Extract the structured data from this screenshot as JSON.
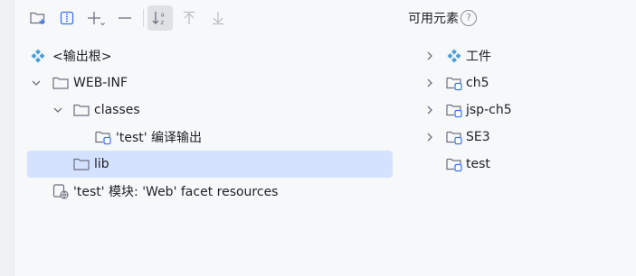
{
  "toolbar": {
    "buttons": [
      {
        "icon": "new-folder-icon"
      },
      {
        "icon": "module-archive-icon"
      },
      {
        "icon": "add-icon"
      },
      {
        "icon": "remove-icon"
      },
      {
        "icon": "sort-alphabetically-icon"
      },
      {
        "icon": "move-up-icon"
      },
      {
        "icon": "move-down-icon"
      }
    ]
  },
  "output_tree": [
    {
      "label": "<输出根>",
      "icon": "output-root-icon",
      "level": 0,
      "expand": "none"
    },
    {
      "label": "WEB-INF",
      "icon": "folder-icon",
      "level": 1,
      "expand": "expanded"
    },
    {
      "label": "classes",
      "icon": "folder-icon",
      "level": 2,
      "expand": "expanded"
    },
    {
      "label": "'test' 编译输出",
      "icon": "module-output-icon",
      "level": 3,
      "expand": "none"
    },
    {
      "label": "lib",
      "icon": "folder-icon",
      "level": 2,
      "expand": "none",
      "selected": true
    },
    {
      "label": "'test' 模块: 'Web' facet resources",
      "icon": "web-facet-icon",
      "level": 1,
      "expand": "none"
    }
  ],
  "available": {
    "title": "可用元素",
    "items": [
      {
        "label": "工件",
        "icon": "artifact-icon",
        "expand": "collapsed"
      },
      {
        "label": "ch5",
        "icon": "module-icon",
        "expand": "collapsed"
      },
      {
        "label": "jsp-ch5",
        "icon": "module-icon",
        "expand": "collapsed"
      },
      {
        "label": "SE3",
        "icon": "module-icon",
        "expand": "collapsed"
      },
      {
        "label": "test",
        "icon": "module-icon",
        "expand": "none"
      }
    ]
  },
  "colors": {
    "selection": "#d4e2ff",
    "accent": "#3574f0",
    "diamond": "#4a9fd8"
  }
}
